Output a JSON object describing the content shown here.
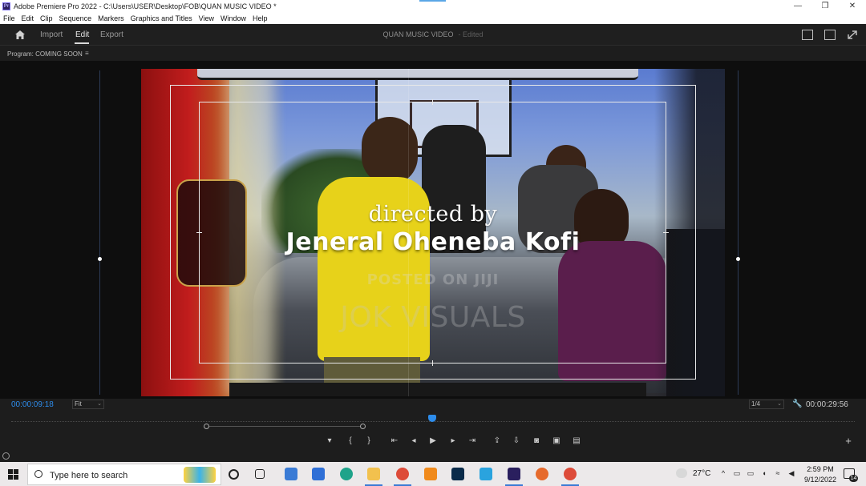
{
  "window": {
    "title": "Adobe Premiere Pro 2022 - C:\\Users\\USER\\Desktop\\FOB\\QUAN MUSIC VIDEO *",
    "controls": [
      "minimize",
      "restore",
      "close"
    ],
    "control_glyphs": [
      "—",
      "❐",
      "✕"
    ]
  },
  "menu": [
    "File",
    "Edit",
    "Clip",
    "Sequence",
    "Markers",
    "Graphics and Titles",
    "View",
    "Window",
    "Help"
  ],
  "workspace": {
    "modes": [
      "Import",
      "Edit",
      "Export"
    ],
    "active_mode": "Edit",
    "project_title": "QUAN MUSIC VIDEO",
    "project_status": "- Edited"
  },
  "program_monitor": {
    "panel_title": "Program: COMING SOON",
    "panel_menu_glyph": "≡",
    "title_line1": "directed by",
    "title_line2": "Jeneral Oheneba Kofi",
    "watermark_line1": "POSTED ON JIJI",
    "watermark_line2": "JOK VISUALS",
    "current_timecode": "00:00:09:18",
    "zoom": "Fit",
    "resolution": "1/4",
    "duration_timecode": "00:00:29:56"
  },
  "transport": {
    "controls": [
      {
        "name": "add-marker-button",
        "glyph": "▾"
      },
      {
        "name": "mark-in-button",
        "glyph": "{"
      },
      {
        "name": "mark-out-button",
        "glyph": "}"
      },
      {
        "name": "go-to-in-button",
        "glyph": "⇤"
      },
      {
        "name": "step-back-button",
        "glyph": "◂"
      },
      {
        "name": "play-button",
        "glyph": "▶"
      },
      {
        "name": "step-forward-button",
        "glyph": "▸"
      },
      {
        "name": "go-to-out-button",
        "glyph": "⇥"
      },
      {
        "name": "lift-button",
        "glyph": "⇪"
      },
      {
        "name": "extract-button",
        "glyph": "⇩"
      },
      {
        "name": "export-frame-button",
        "glyph": "◙"
      },
      {
        "name": "insert-button",
        "glyph": "▣"
      },
      {
        "name": "comparison-view-button",
        "glyph": "▤"
      }
    ],
    "add_button_glyph": "+"
  },
  "taskbar": {
    "search_placeholder": "Type here to search",
    "weather": "27°C",
    "tray_glyphs": [
      "^",
      "▭",
      "▭",
      "◖",
      "≈",
      "◀"
    ],
    "time": "2:59 PM",
    "date": "9/12/2022",
    "notification_count": "14",
    "apps": [
      {
        "name": "cortana-icon",
        "color": "#222222"
      },
      {
        "name": "task-view-icon",
        "color": "#222222"
      },
      {
        "name": "store-icon",
        "color": "#3a7bd5"
      },
      {
        "name": "mail-icon",
        "color": "#2f6fd6"
      },
      {
        "name": "edge-icon",
        "color": "#1fa38a"
      },
      {
        "name": "file-explorer-icon",
        "color": "#f2c14e"
      },
      {
        "name": "chrome-icon",
        "color": "#dd4b39"
      },
      {
        "name": "vlc-icon",
        "color": "#f08a1c"
      },
      {
        "name": "photoshop-icon",
        "color": "#0a2b4a"
      },
      {
        "name": "telegram-icon",
        "color": "#2aa3de"
      },
      {
        "name": "premiere-icon",
        "color": "#2a1f5e"
      },
      {
        "name": "firefox-icon",
        "color": "#e66a2c"
      },
      {
        "name": "chrome-profile-icon",
        "color": "#dd4b39"
      }
    ]
  },
  "colors": {
    "accent_blue": "#2d8ceb",
    "panel_bg": "#1d1d1d",
    "taskbar_bg": "#ece9ea"
  }
}
